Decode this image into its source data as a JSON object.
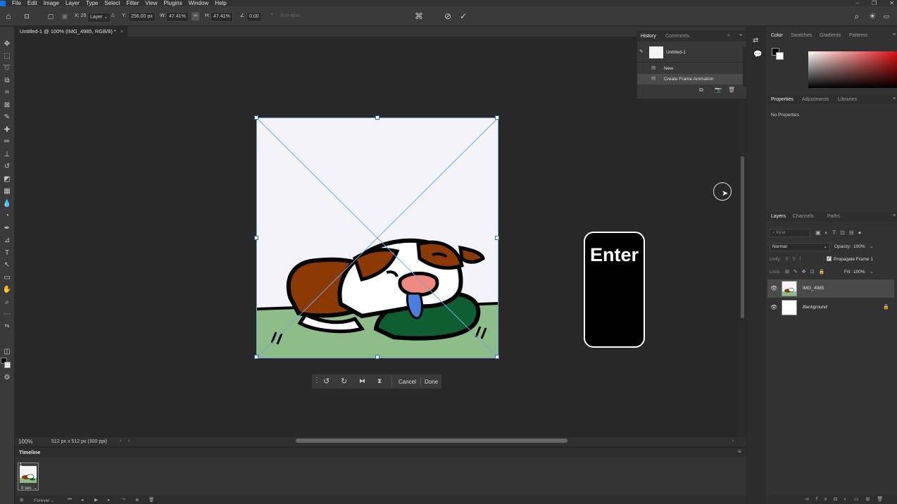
{
  "app": {
    "menu": [
      "File",
      "Edit",
      "Image",
      "Layer",
      "Type",
      "Select",
      "Filter",
      "View",
      "Plugins",
      "Window",
      "Help"
    ]
  },
  "options_bar": {
    "x_label": "X: 25",
    "ref_dropdown": "Layer",
    "y_label": "Y:",
    "y_value": "256.00 px",
    "w_label": "W:",
    "w_value": "47.41%",
    "h_label": "H:",
    "h_value": "47.41%",
    "angle_label": "∠",
    "angle_value": "0.00",
    "antialias": "Anti-alias"
  },
  "document": {
    "tab_title": "Untitled-1 @ 100% (IMG_4985, RGB/8) *",
    "zoom": "100%",
    "doc_info": "512 px x 512 px (300 ppi)"
  },
  "contextual_bar": {
    "cancel": "Cancel",
    "done": "Done"
  },
  "overlay": {
    "key_label": "Enter"
  },
  "history_panel": {
    "tabs": [
      "History",
      "Comments"
    ],
    "snapshot": "Untitled-1",
    "states": [
      "New",
      "Create Frame Animation"
    ]
  },
  "color_panel": {
    "tabs": [
      "Color",
      "Swatches",
      "Gradients",
      "Patterns"
    ],
    "colors": {
      "foreground": "#000000",
      "background": "#ffffff"
    }
  },
  "properties_panel": {
    "tabs": [
      "Properties",
      "Adjustments",
      "Libraries"
    ],
    "empty_text": "No Properties"
  },
  "layers_panel": {
    "tabs": [
      "Layers",
      "Channels",
      "Paths"
    ],
    "kind_placeholder": "Kind",
    "blend_mode": "Normal",
    "opacity_label": "Opacity:",
    "opacity_value": "100%",
    "unify_label": "Unify:",
    "propagate_label": "Propagate Frame 1",
    "lock_label": "Lock:",
    "fill_label": "Fill:",
    "fill_value": "100%",
    "layers": [
      {
        "name": "IMG_4985",
        "selected": true
      },
      {
        "name": "Background",
        "locked": true
      }
    ]
  },
  "timeline": {
    "title": "Timeline",
    "frame_number": "1",
    "frame_delay": "0 sec.",
    "loop": "Forever"
  }
}
